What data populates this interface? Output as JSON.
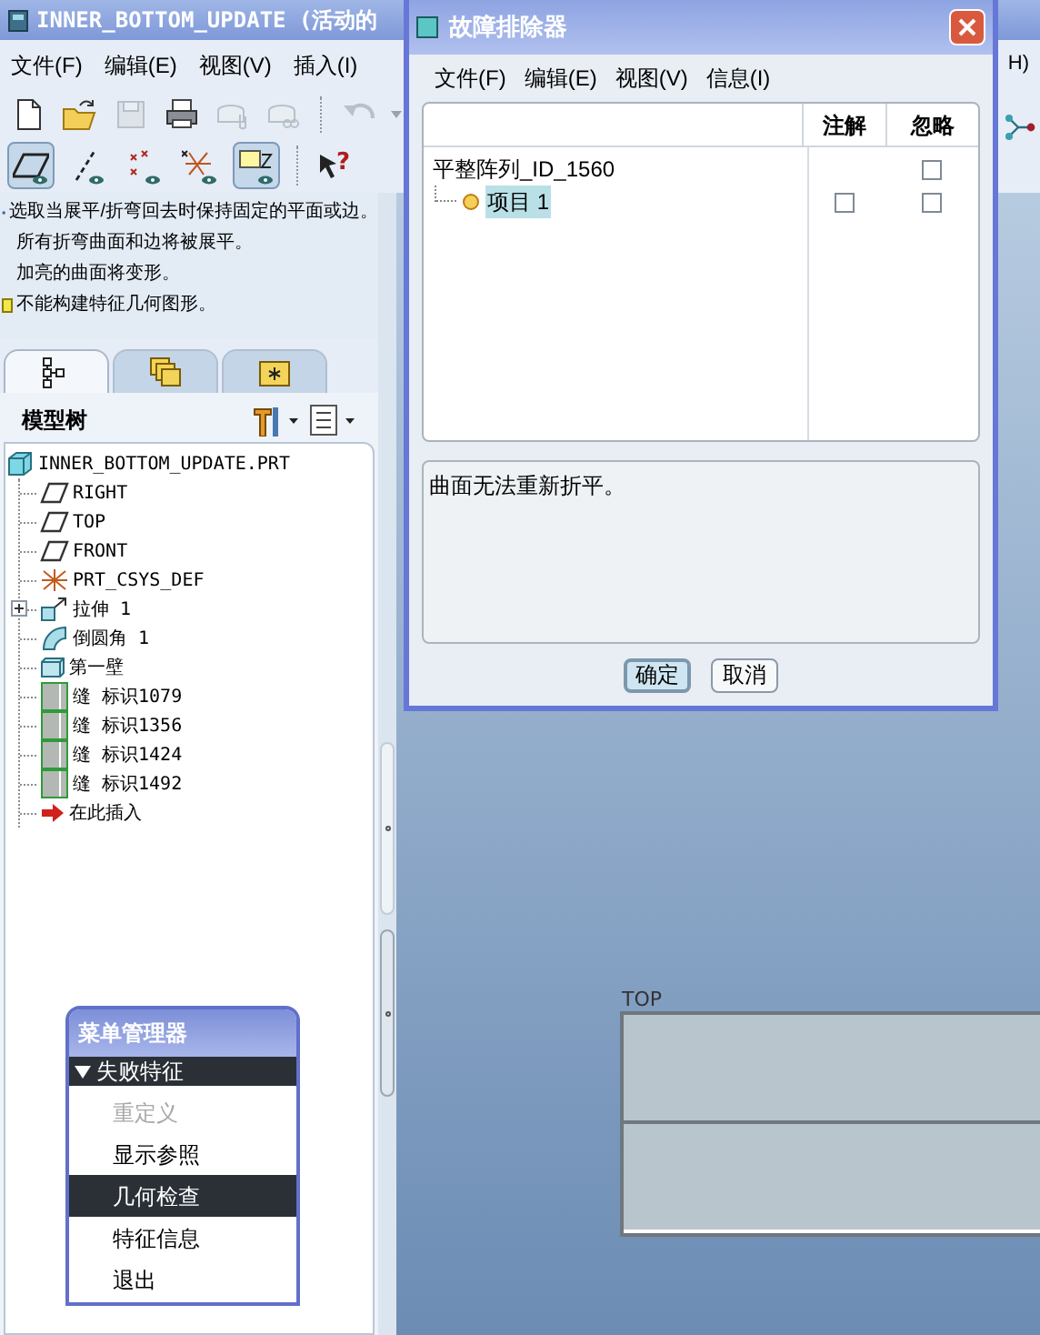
{
  "main_window": {
    "title": "INNER_BOTTOM_UPDATE (活动的",
    "menu": [
      {
        "label": "文件(F)"
      },
      {
        "label": "编辑(E)"
      },
      {
        "label": "视图(V)"
      },
      {
        "label": "插入(I)"
      },
      {
        "label": "H)"
      }
    ],
    "toolbar_1": [
      {
        "disabled": false
      },
      {
        "disabled": false
      },
      {
        "disabled": true
      },
      {
        "disabled": false
      },
      {
        "disabled": true
      },
      {
        "disabled": true
      },
      {
        "disabled": true
      }
    ],
    "toolbar_2": [
      {
        "on": true
      },
      {
        "on": false
      },
      {
        "on": false
      },
      {
        "on": false
      },
      {
        "on": true
      }
    ],
    "help_glyph": "?",
    "messages": [
      {
        "kind": "prompt",
        "text": "选取当展平/折弯回去时保持固定的平面或边。"
      },
      {
        "kind": "info",
        "text": "所有折弯曲面和边将被展平。"
      },
      {
        "kind": "info",
        "text": "加亮的曲面将变形。"
      },
      {
        "kind": "warning",
        "text": "不能构建特征几何图形。"
      }
    ],
    "tabs": [
      {
        "selected": true
      },
      {
        "selected": false
      },
      {
        "selected": false
      }
    ],
    "model_tree": {
      "title": "模型树",
      "items": [
        {
          "label": "INNER_BOTTOM_UPDATE.PRT",
          "kind": "part",
          "children": [
            {
              "label": "RIGHT",
              "kind": "datum_plane"
            },
            {
              "label": "TOP",
              "kind": "datum_plane"
            },
            {
              "label": "FRONT",
              "kind": "datum_plane"
            },
            {
              "label": "PRT_CSYS_DEF",
              "kind": "csys"
            },
            {
              "label": "拉伸 1",
              "kind": "extrude",
              "expanded": false
            },
            {
              "label": "倒圆角 1",
              "kind": "round"
            },
            {
              "label": "第一壁",
              "kind": "wall"
            },
            {
              "label": "缝 标识1079",
              "kind": "seam"
            },
            {
              "label": "缝 标识1356",
              "kind": "seam"
            },
            {
              "label": "缝 标识1424",
              "kind": "seam"
            },
            {
              "label": "缝 标识1492",
              "kind": "seam"
            },
            {
              "label": "在此插入",
              "kind": "insert"
            }
          ]
        }
      ]
    },
    "graphics": {
      "datum_label": "TOP"
    }
  },
  "troubleshooter": {
    "title": "故障排除器",
    "menu": [
      {
        "label": "文件(F)"
      },
      {
        "label": "编辑(E)"
      },
      {
        "label": "视图(V)"
      },
      {
        "label": "信息(I)"
      }
    ],
    "columns": [
      "注解",
      "忽略"
    ],
    "items": [
      {
        "label": "平整阵列_ID_1560",
        "ignore": false,
        "children": [
          {
            "label": "项目 1",
            "selected": true,
            "note": false,
            "ignore": false
          }
        ]
      }
    ],
    "message": "曲面无法重新折平。",
    "buttons": [
      {
        "label": "确定",
        "default": true
      },
      {
        "label": "取消",
        "default": false
      }
    ]
  },
  "menu_manager": {
    "title": "菜单管理器",
    "section": {
      "label": "失败特征",
      "expanded": true
    },
    "items": [
      {
        "label": "重定义",
        "disabled": true,
        "selected": false
      },
      {
        "label": "显示参照",
        "disabled": false,
        "selected": false
      },
      {
        "label": "几何检查",
        "disabled": false,
        "selected": true
      },
      {
        "label": "特征信息",
        "disabled": false,
        "selected": false
      },
      {
        "label": "退出",
        "disabled": false,
        "selected": false
      }
    ]
  }
}
